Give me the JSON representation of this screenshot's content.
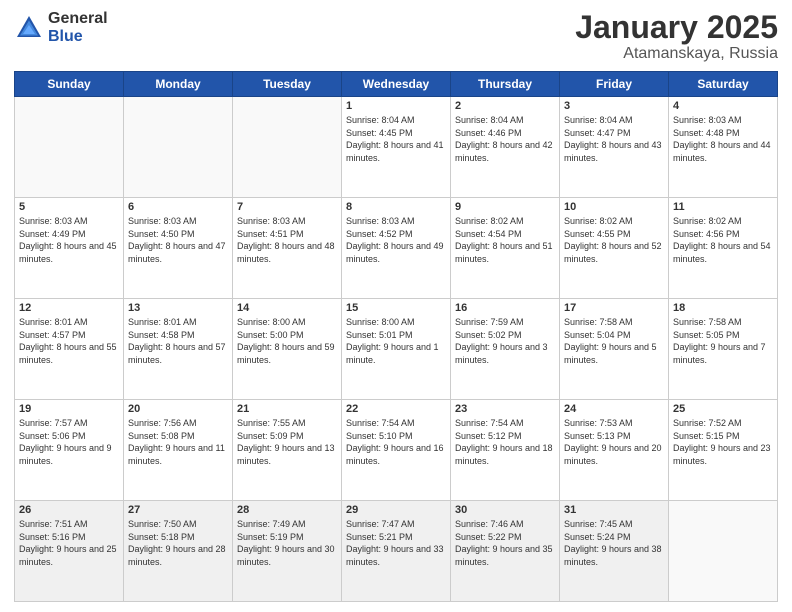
{
  "header": {
    "logo_general": "General",
    "logo_blue": "Blue",
    "month_title": "January 2025",
    "location": "Atamanskaya, Russia"
  },
  "weekdays": [
    "Sunday",
    "Monday",
    "Tuesday",
    "Wednesday",
    "Thursday",
    "Friday",
    "Saturday"
  ],
  "weeks": [
    [
      {
        "day": "",
        "info": ""
      },
      {
        "day": "",
        "info": ""
      },
      {
        "day": "",
        "info": ""
      },
      {
        "day": "1",
        "info": "Sunrise: 8:04 AM\nSunset: 4:45 PM\nDaylight: 8 hours and 41 minutes."
      },
      {
        "day": "2",
        "info": "Sunrise: 8:04 AM\nSunset: 4:46 PM\nDaylight: 8 hours and 42 minutes."
      },
      {
        "day": "3",
        "info": "Sunrise: 8:04 AM\nSunset: 4:47 PM\nDaylight: 8 hours and 43 minutes."
      },
      {
        "day": "4",
        "info": "Sunrise: 8:03 AM\nSunset: 4:48 PM\nDaylight: 8 hours and 44 minutes."
      }
    ],
    [
      {
        "day": "5",
        "info": "Sunrise: 8:03 AM\nSunset: 4:49 PM\nDaylight: 8 hours and 45 minutes."
      },
      {
        "day": "6",
        "info": "Sunrise: 8:03 AM\nSunset: 4:50 PM\nDaylight: 8 hours and 47 minutes."
      },
      {
        "day": "7",
        "info": "Sunrise: 8:03 AM\nSunset: 4:51 PM\nDaylight: 8 hours and 48 minutes."
      },
      {
        "day": "8",
        "info": "Sunrise: 8:03 AM\nSunset: 4:52 PM\nDaylight: 8 hours and 49 minutes."
      },
      {
        "day": "9",
        "info": "Sunrise: 8:02 AM\nSunset: 4:54 PM\nDaylight: 8 hours and 51 minutes."
      },
      {
        "day": "10",
        "info": "Sunrise: 8:02 AM\nSunset: 4:55 PM\nDaylight: 8 hours and 52 minutes."
      },
      {
        "day": "11",
        "info": "Sunrise: 8:02 AM\nSunset: 4:56 PM\nDaylight: 8 hours and 54 minutes."
      }
    ],
    [
      {
        "day": "12",
        "info": "Sunrise: 8:01 AM\nSunset: 4:57 PM\nDaylight: 8 hours and 55 minutes."
      },
      {
        "day": "13",
        "info": "Sunrise: 8:01 AM\nSunset: 4:58 PM\nDaylight: 8 hours and 57 minutes."
      },
      {
        "day": "14",
        "info": "Sunrise: 8:00 AM\nSunset: 5:00 PM\nDaylight: 8 hours and 59 minutes."
      },
      {
        "day": "15",
        "info": "Sunrise: 8:00 AM\nSunset: 5:01 PM\nDaylight: 9 hours and 1 minute."
      },
      {
        "day": "16",
        "info": "Sunrise: 7:59 AM\nSunset: 5:02 PM\nDaylight: 9 hours and 3 minutes."
      },
      {
        "day": "17",
        "info": "Sunrise: 7:58 AM\nSunset: 5:04 PM\nDaylight: 9 hours and 5 minutes."
      },
      {
        "day": "18",
        "info": "Sunrise: 7:58 AM\nSunset: 5:05 PM\nDaylight: 9 hours and 7 minutes."
      }
    ],
    [
      {
        "day": "19",
        "info": "Sunrise: 7:57 AM\nSunset: 5:06 PM\nDaylight: 9 hours and 9 minutes."
      },
      {
        "day": "20",
        "info": "Sunrise: 7:56 AM\nSunset: 5:08 PM\nDaylight: 9 hours and 11 minutes."
      },
      {
        "day": "21",
        "info": "Sunrise: 7:55 AM\nSunset: 5:09 PM\nDaylight: 9 hours and 13 minutes."
      },
      {
        "day": "22",
        "info": "Sunrise: 7:54 AM\nSunset: 5:10 PM\nDaylight: 9 hours and 16 minutes."
      },
      {
        "day": "23",
        "info": "Sunrise: 7:54 AM\nSunset: 5:12 PM\nDaylight: 9 hours and 18 minutes."
      },
      {
        "day": "24",
        "info": "Sunrise: 7:53 AM\nSunset: 5:13 PM\nDaylight: 9 hours and 20 minutes."
      },
      {
        "day": "25",
        "info": "Sunrise: 7:52 AM\nSunset: 5:15 PM\nDaylight: 9 hours and 23 minutes."
      }
    ],
    [
      {
        "day": "26",
        "info": "Sunrise: 7:51 AM\nSunset: 5:16 PM\nDaylight: 9 hours and 25 minutes."
      },
      {
        "day": "27",
        "info": "Sunrise: 7:50 AM\nSunset: 5:18 PM\nDaylight: 9 hours and 28 minutes."
      },
      {
        "day": "28",
        "info": "Sunrise: 7:49 AM\nSunset: 5:19 PM\nDaylight: 9 hours and 30 minutes."
      },
      {
        "day": "29",
        "info": "Sunrise: 7:47 AM\nSunset: 5:21 PM\nDaylight: 9 hours and 33 minutes."
      },
      {
        "day": "30",
        "info": "Sunrise: 7:46 AM\nSunset: 5:22 PM\nDaylight: 9 hours and 35 minutes."
      },
      {
        "day": "31",
        "info": "Sunrise: 7:45 AM\nSunset: 5:24 PM\nDaylight: 9 hours and 38 minutes."
      },
      {
        "day": "",
        "info": ""
      }
    ]
  ]
}
